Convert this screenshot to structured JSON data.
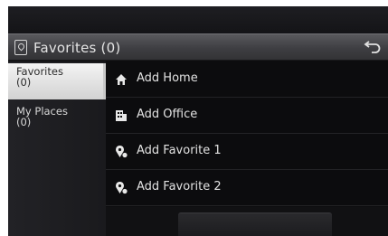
{
  "header": {
    "title": "Favorites (0)"
  },
  "sidebar": {
    "items": [
      {
        "line1": "Favorites",
        "line2": "(0)"
      },
      {
        "line1": "My Places",
        "line2": "(0)"
      }
    ]
  },
  "list": {
    "items": [
      {
        "label": "Add Home",
        "icon": "home-icon"
      },
      {
        "label": "Add Office",
        "icon": "office-icon"
      },
      {
        "label": "Add Favorite 1",
        "icon": "favorite-pin-icon"
      },
      {
        "label": "Add Favorite 2",
        "icon": "favorite-pin-icon"
      }
    ]
  }
}
